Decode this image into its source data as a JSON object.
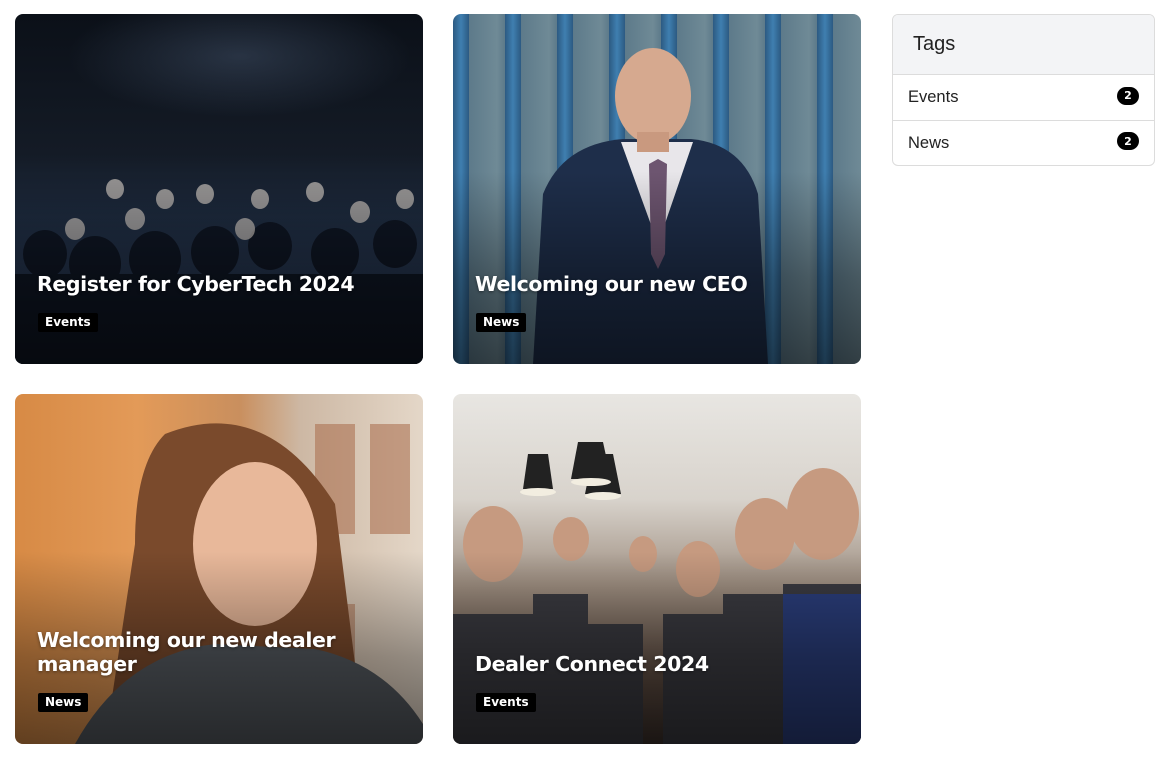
{
  "cards": [
    {
      "title": "Register for CyberTech 2024",
      "tag": "Events"
    },
    {
      "title": "Welcoming our new CEO",
      "tag": "News"
    },
    {
      "title": "Welcoming our new dealer manager",
      "tag": "News"
    },
    {
      "title": "Dealer Connect 2024",
      "tag": "Events"
    }
  ],
  "tags_panel": {
    "heading": "Tags",
    "items": [
      {
        "label": "Events",
        "count": "2"
      },
      {
        "label": "News",
        "count": "2"
      }
    ]
  }
}
